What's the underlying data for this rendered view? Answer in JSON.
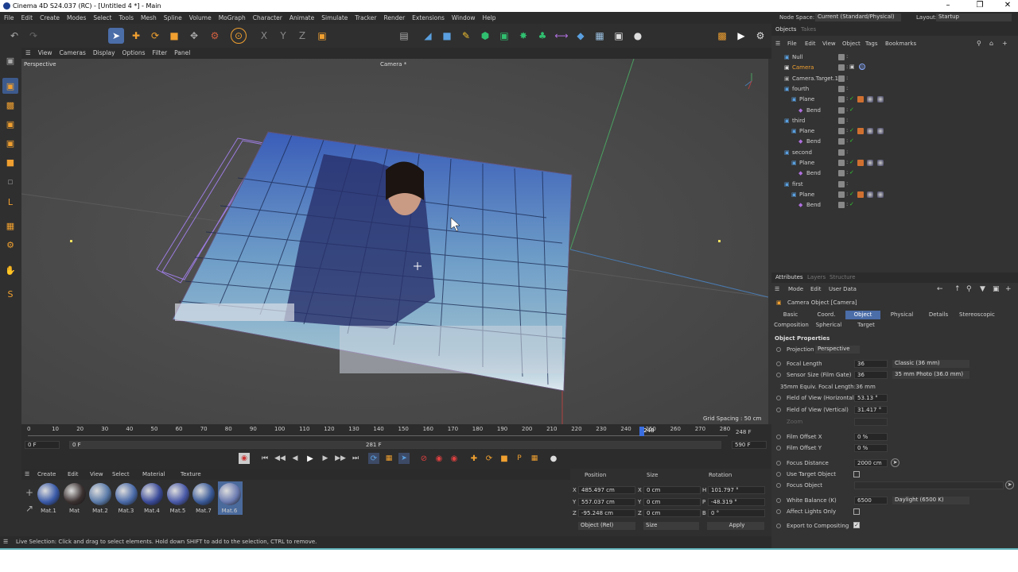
{
  "window": {
    "title": "Cinema 4D S24.037 (RC) - [Untitled 4 *] - Main"
  },
  "menubar": [
    "File",
    "Edit",
    "Create",
    "Modes",
    "Select",
    "Tools",
    "Mesh",
    "Spline",
    "Volume",
    "MoGraph",
    "Character",
    "Animate",
    "Simulate",
    "Tracker",
    "Render",
    "Extensions",
    "Window",
    "Help"
  ],
  "topright": {
    "node_space_label": "Node Space:",
    "node_space_value": "Current (Standard/Physical)",
    "layout_label": "Layout:",
    "layout_value": "Startup"
  },
  "viewport_menu": [
    "View",
    "Cameras",
    "Display",
    "Options",
    "Filter",
    "Panel"
  ],
  "viewport": {
    "name": "Perspective",
    "camera_label": "Camera *",
    "grid_spacing": "Grid Spacing : 50 cm"
  },
  "timeline": {
    "ticks": [
      "0",
      "10",
      "20",
      "30",
      "40",
      "50",
      "60",
      "70",
      "80",
      "90",
      "100",
      "110",
      "120",
      "130",
      "140",
      "150",
      "160",
      "170",
      "180",
      "190",
      "200",
      "210",
      "220",
      "230",
      "240",
      "250",
      "260",
      "270",
      "280"
    ],
    "end_frame": "248 F",
    "start_field": "0 F",
    "min_field": "0 F",
    "mid_marker": "281 F",
    "max_field": "590 F",
    "current_frame_label": "248",
    "current_frame": 248
  },
  "material_manager": {
    "menu": [
      "Create",
      "Edit",
      "View",
      "Select",
      "Material",
      "Texture"
    ],
    "materials": [
      "Mat.1",
      "Mat",
      "Mat.2",
      "Mat.3",
      "Mat.4",
      "Mat.5",
      "Mat.7",
      "Mat.6"
    ]
  },
  "coordinates": {
    "headers": [
      "Position",
      "Size",
      "Rotation"
    ],
    "rows": [
      {
        "axis": "X",
        "pos": "485.497 cm",
        "size_axis": "X",
        "size": "0 cm",
        "rot_axis": "H",
        "rot": "101.797 °"
      },
      {
        "axis": "Y",
        "pos": "557.037 cm",
        "size_axis": "Y",
        "size": "0 cm",
        "rot_axis": "P",
        "rot": "-48.319 °"
      },
      {
        "axis": "Z",
        "pos": "-95.248 cm",
        "size_axis": "Z",
        "size": "0 cm",
        "rot_axis": "B",
        "rot": "0 °"
      }
    ],
    "mode": "Object (Rel)",
    "size_mode": "Size",
    "apply": "Apply"
  },
  "status": "Live Selection: Click and drag to select elements. Hold down SHIFT to add to the selection, CTRL to remove.",
  "objects_panel": {
    "tabs": [
      "Objects",
      "Takes"
    ],
    "menu": [
      "File",
      "Edit",
      "View",
      "Object",
      "Tags",
      "Bookmarks"
    ],
    "items": [
      {
        "name": "Null"
      },
      {
        "name": "Camera"
      },
      {
        "name": "Camera.Target.1"
      },
      {
        "name": "fourth"
      },
      {
        "name": "Plane"
      },
      {
        "name": "Bend"
      },
      {
        "name": "third"
      },
      {
        "name": "Plane"
      },
      {
        "name": "Bend"
      },
      {
        "name": "second"
      },
      {
        "name": "Plane"
      },
      {
        "name": "Bend"
      },
      {
        "name": "first"
      },
      {
        "name": "Plane"
      },
      {
        "name": "Bend"
      }
    ]
  },
  "attributes": {
    "tabs": [
      "Attributes",
      "Layers",
      "Structure"
    ],
    "menu": [
      "Mode",
      "Edit",
      "User Data"
    ],
    "object_title": "Camera Object [Camera]",
    "subtabs_row1": [
      "Basic",
      "Coord.",
      "Object",
      "Physical",
      "Details",
      "Stereoscopic"
    ],
    "subtabs_row2": [
      "Composition",
      "Spherical",
      "Target"
    ],
    "section": "Object Properties",
    "projection_label": "Projection",
    "projection_value": "Perspective",
    "focal_length_label": "Focal Length",
    "focal_length": "36",
    "focal_preset": "Classic (36 mm)",
    "sensor_label": "Sensor Size (Film Gate)",
    "sensor": "36",
    "sensor_preset": "35 mm Photo (36.0 mm)",
    "equiv_label": "35mm Equiv. Focal Length:",
    "equiv": "36 mm",
    "fov_h_label": "Field of View (Horizontal)",
    "fov_h": "53.13 °",
    "fov_v_label": "Field of View (Vertical)",
    "fov_v": "31.417 °",
    "zoom_label": "Zoom",
    "film_x_label": "Film Offset X",
    "film_x": "0 %",
    "film_y_label": "Film Offset Y",
    "film_y": "0 %",
    "focus_dist_label": "Focus Distance",
    "focus_dist": "2000 cm",
    "use_target_label": "Use Target Object",
    "focus_obj_label": "Focus Object",
    "wb_label": "White Balance (K)",
    "wb": "6500",
    "wb_preset": "Daylight (6500 K)",
    "affect_lights_label": "Affect Lights Only",
    "export_label": "Export to Compositing"
  }
}
